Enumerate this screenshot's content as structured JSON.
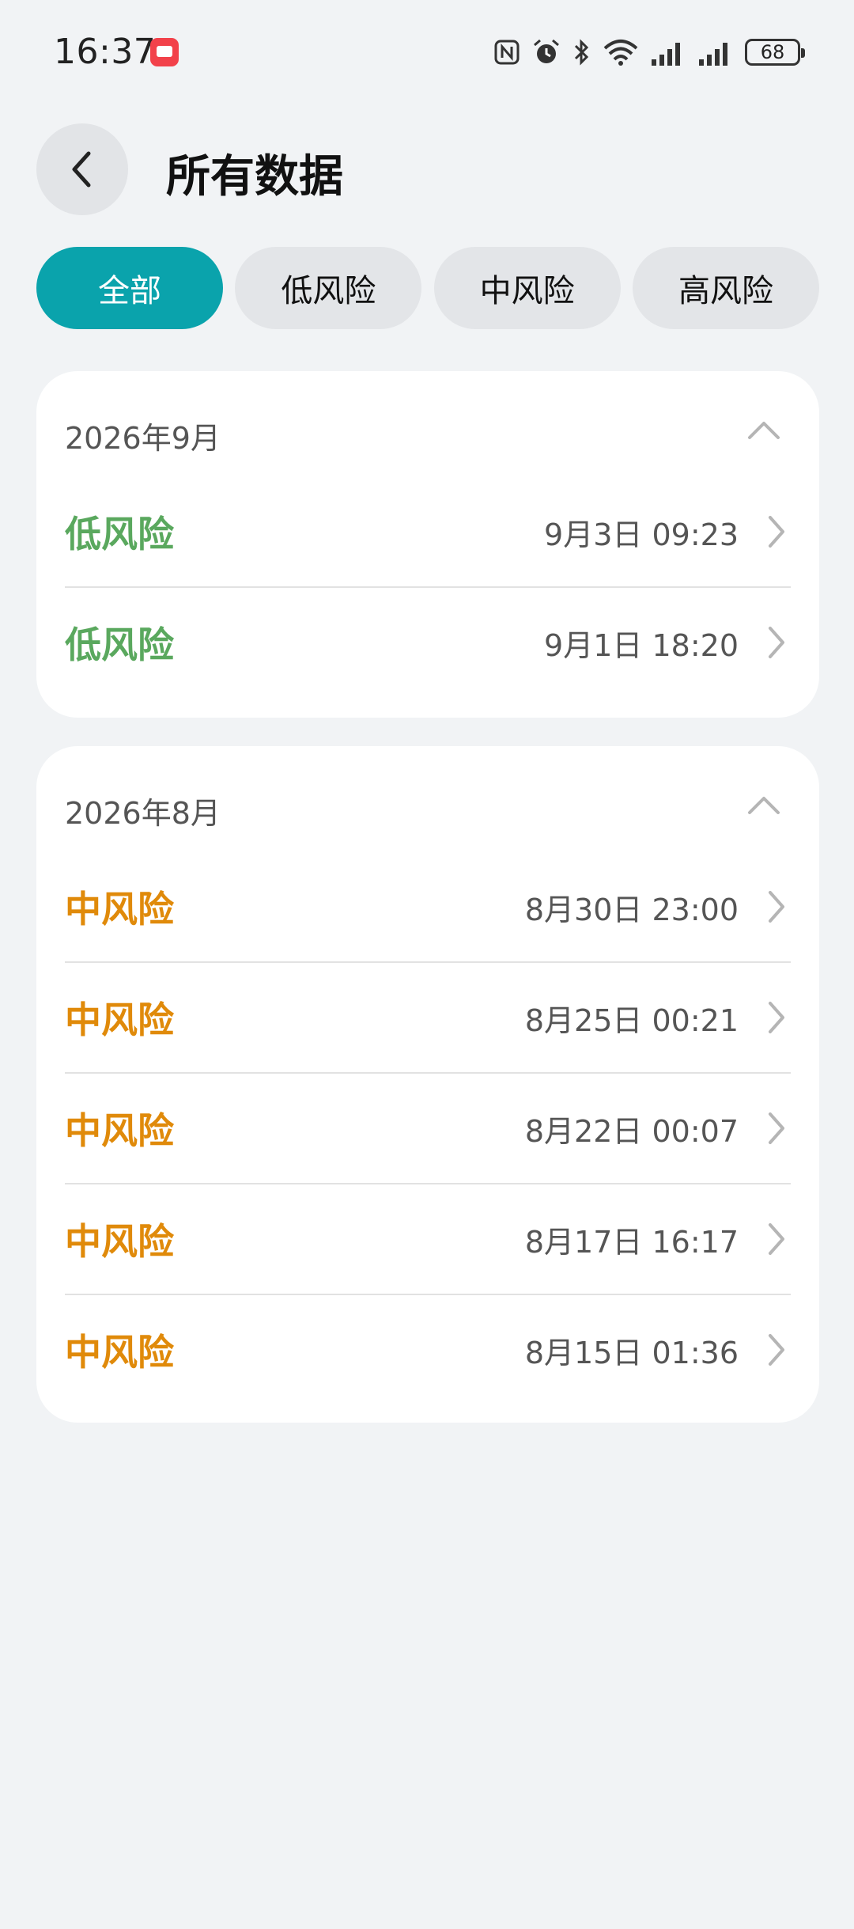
{
  "status_bar": {
    "time": "16:37",
    "battery": "68"
  },
  "header": {
    "title": "所有数据"
  },
  "filters": [
    {
      "label": "全部",
      "active": true
    },
    {
      "label": "低风险",
      "active": false
    },
    {
      "label": "中风险",
      "active": false
    },
    {
      "label": "高风险",
      "active": false
    }
  ],
  "groups": [
    {
      "month": "2026年9月",
      "rows": [
        {
          "risk": "低风险",
          "time": "9月3日 09:23"
        },
        {
          "risk": "低风险",
          "time": "9月1日 18:20"
        }
      ]
    },
    {
      "month": "2026年8月",
      "rows": [
        {
          "risk": "中风险",
          "time": "8月30日 23:00"
        },
        {
          "risk": "中风险",
          "time": "8月25日 00:21"
        },
        {
          "risk": "中风险",
          "time": "8月22日 00:07"
        },
        {
          "risk": "中风险",
          "time": "8月17日 16:17"
        },
        {
          "risk": "中风险",
          "time": "8月15日 01:36"
        }
      ]
    }
  ],
  "colors": {
    "accent": "#0aa3ac",
    "low_risk": "#5aa85e",
    "mid_risk": "#e08a0a"
  }
}
